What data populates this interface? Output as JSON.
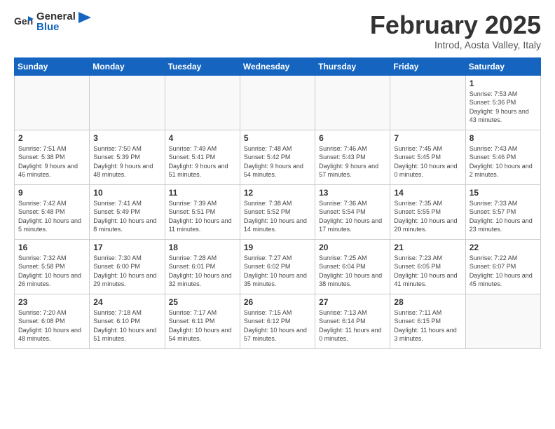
{
  "header": {
    "logo_general": "General",
    "logo_blue": "Blue",
    "month_title": "February 2025",
    "location": "Introd, Aosta Valley, Italy"
  },
  "days_of_week": [
    "Sunday",
    "Monday",
    "Tuesday",
    "Wednesday",
    "Thursday",
    "Friday",
    "Saturday"
  ],
  "weeks": [
    [
      {
        "day": "",
        "info": ""
      },
      {
        "day": "",
        "info": ""
      },
      {
        "day": "",
        "info": ""
      },
      {
        "day": "",
        "info": ""
      },
      {
        "day": "",
        "info": ""
      },
      {
        "day": "",
        "info": ""
      },
      {
        "day": "1",
        "info": "Sunrise: 7:53 AM\nSunset: 5:36 PM\nDaylight: 9 hours and 43 minutes."
      }
    ],
    [
      {
        "day": "2",
        "info": "Sunrise: 7:51 AM\nSunset: 5:38 PM\nDaylight: 9 hours and 46 minutes."
      },
      {
        "day": "3",
        "info": "Sunrise: 7:50 AM\nSunset: 5:39 PM\nDaylight: 9 hours and 48 minutes."
      },
      {
        "day": "4",
        "info": "Sunrise: 7:49 AM\nSunset: 5:41 PM\nDaylight: 9 hours and 51 minutes."
      },
      {
        "day": "5",
        "info": "Sunrise: 7:48 AM\nSunset: 5:42 PM\nDaylight: 9 hours and 54 minutes."
      },
      {
        "day": "6",
        "info": "Sunrise: 7:46 AM\nSunset: 5:43 PM\nDaylight: 9 hours and 57 minutes."
      },
      {
        "day": "7",
        "info": "Sunrise: 7:45 AM\nSunset: 5:45 PM\nDaylight: 10 hours and 0 minutes."
      },
      {
        "day": "8",
        "info": "Sunrise: 7:43 AM\nSunset: 5:46 PM\nDaylight: 10 hours and 2 minutes."
      }
    ],
    [
      {
        "day": "9",
        "info": "Sunrise: 7:42 AM\nSunset: 5:48 PM\nDaylight: 10 hours and 5 minutes."
      },
      {
        "day": "10",
        "info": "Sunrise: 7:41 AM\nSunset: 5:49 PM\nDaylight: 10 hours and 8 minutes."
      },
      {
        "day": "11",
        "info": "Sunrise: 7:39 AM\nSunset: 5:51 PM\nDaylight: 10 hours and 11 minutes."
      },
      {
        "day": "12",
        "info": "Sunrise: 7:38 AM\nSunset: 5:52 PM\nDaylight: 10 hours and 14 minutes."
      },
      {
        "day": "13",
        "info": "Sunrise: 7:36 AM\nSunset: 5:54 PM\nDaylight: 10 hours and 17 minutes."
      },
      {
        "day": "14",
        "info": "Sunrise: 7:35 AM\nSunset: 5:55 PM\nDaylight: 10 hours and 20 minutes."
      },
      {
        "day": "15",
        "info": "Sunrise: 7:33 AM\nSunset: 5:57 PM\nDaylight: 10 hours and 23 minutes."
      }
    ],
    [
      {
        "day": "16",
        "info": "Sunrise: 7:32 AM\nSunset: 5:58 PM\nDaylight: 10 hours and 26 minutes."
      },
      {
        "day": "17",
        "info": "Sunrise: 7:30 AM\nSunset: 6:00 PM\nDaylight: 10 hours and 29 minutes."
      },
      {
        "day": "18",
        "info": "Sunrise: 7:28 AM\nSunset: 6:01 PM\nDaylight: 10 hours and 32 minutes."
      },
      {
        "day": "19",
        "info": "Sunrise: 7:27 AM\nSunset: 6:02 PM\nDaylight: 10 hours and 35 minutes."
      },
      {
        "day": "20",
        "info": "Sunrise: 7:25 AM\nSunset: 6:04 PM\nDaylight: 10 hours and 38 minutes."
      },
      {
        "day": "21",
        "info": "Sunrise: 7:23 AM\nSunset: 6:05 PM\nDaylight: 10 hours and 41 minutes."
      },
      {
        "day": "22",
        "info": "Sunrise: 7:22 AM\nSunset: 6:07 PM\nDaylight: 10 hours and 45 minutes."
      }
    ],
    [
      {
        "day": "23",
        "info": "Sunrise: 7:20 AM\nSunset: 6:08 PM\nDaylight: 10 hours and 48 minutes."
      },
      {
        "day": "24",
        "info": "Sunrise: 7:18 AM\nSunset: 6:10 PM\nDaylight: 10 hours and 51 minutes."
      },
      {
        "day": "25",
        "info": "Sunrise: 7:17 AM\nSunset: 6:11 PM\nDaylight: 10 hours and 54 minutes."
      },
      {
        "day": "26",
        "info": "Sunrise: 7:15 AM\nSunset: 6:12 PM\nDaylight: 10 hours and 57 minutes."
      },
      {
        "day": "27",
        "info": "Sunrise: 7:13 AM\nSunset: 6:14 PM\nDaylight: 11 hours and 0 minutes."
      },
      {
        "day": "28",
        "info": "Sunrise: 7:11 AM\nSunset: 6:15 PM\nDaylight: 11 hours and 3 minutes."
      },
      {
        "day": "",
        "info": ""
      }
    ]
  ]
}
